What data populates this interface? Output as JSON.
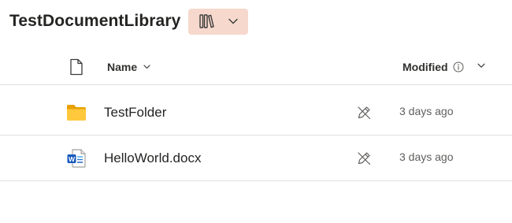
{
  "library": {
    "title": "TestDocumentLibrary",
    "view_switcher_icon": "library-icon",
    "view_switcher_chevron": "chevron-down-icon",
    "view_switcher_bg": "#f6d8cd"
  },
  "columns": {
    "type_icon": "file-type-icon",
    "name": "Name",
    "modified": "Modified",
    "info_icon": "info-icon"
  },
  "rows": [
    {
      "icon": "folder-icon",
      "name": "TestFolder",
      "status_icon": "edit-off-icon",
      "modified": "3 days ago"
    },
    {
      "icon": "word-doc-icon",
      "name": "HelloWorld.docx",
      "status_icon": "edit-off-icon",
      "modified": "3 days ago"
    }
  ],
  "colors": {
    "folder": "#f4b400",
    "word": "#2b579a",
    "divider": "#e1dfdd"
  }
}
